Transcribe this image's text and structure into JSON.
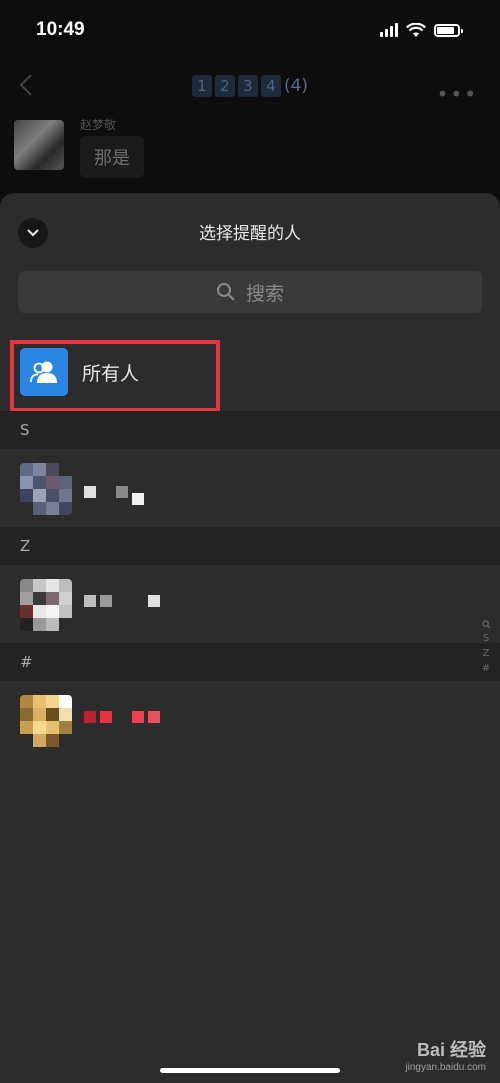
{
  "status_bar": {
    "time": "10:49"
  },
  "chat": {
    "title_boxes": [
      "1",
      "2",
      "3",
      "4"
    ],
    "title_count": "(4)",
    "sender_name": "赵梦敬",
    "message": "那是"
  },
  "sheet": {
    "title": "选择提醒的人",
    "search_placeholder": "搜索",
    "everyone_label": "所有人",
    "sections": [
      {
        "letter": "S"
      },
      {
        "letter": "Z"
      },
      {
        "letter": "#"
      }
    ],
    "index_letters": [
      "S",
      "Z",
      "#"
    ]
  },
  "watermark": {
    "brand": "Bai 经验",
    "url": "jingyan.baidu.com"
  },
  "colors": {
    "sheet_bg": "#2c2c2c",
    "section_bg": "#232323",
    "accent_blue": "#2b86e3",
    "highlight_red": "#e2353f"
  }
}
